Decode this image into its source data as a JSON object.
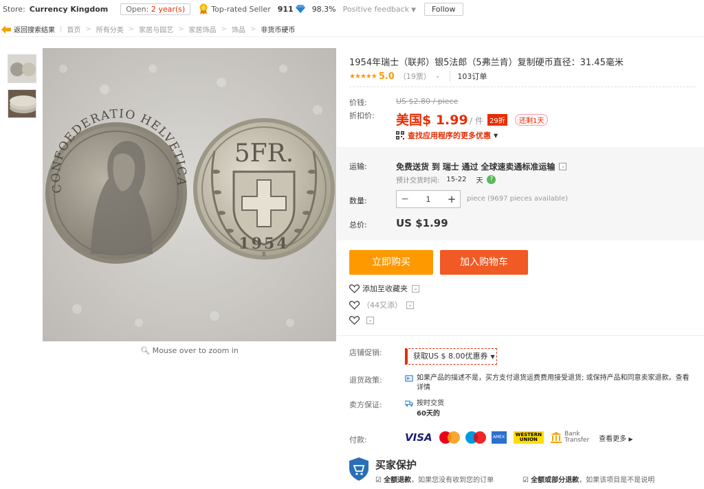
{
  "store": {
    "label": "Store:",
    "name": "Currency Kingdom",
    "open_prefix": "Open:",
    "open_years": "2 year(s)",
    "top_rated": "Top-rated Seller",
    "feedback_score": "911",
    "positive_pct": "98.3%",
    "positive_label": "Positive feedback",
    "follow": "Follow"
  },
  "breadcrumb": {
    "back": "返回搜索结果",
    "items": [
      "首页",
      "所有分类",
      "家居与园艺",
      "家居饰品",
      "饰品"
    ],
    "current": "非货币硬币"
  },
  "gallery": {
    "zoom_hint": "Mouse over to zoom in",
    "coin_left_text": "CONFOEDERATIO HELVETICA",
    "coin_right_denom": "5FR.",
    "coin_right_year": "1954",
    "coin_right_mint": "B"
  },
  "product": {
    "title": "1954年瑞士（联邦）银5法郎（5弗兰肯）复制硬币直径：31.45毫米",
    "rating": "5.0",
    "rating_count": "（19票）",
    "orders": "103订单"
  },
  "price": {
    "label_price": "价钱:",
    "old_price": "US $2.80 / piece",
    "label_discount": "折扣价:",
    "new_price": "美国$ 1.99",
    "per_piece": "/ 件",
    "discount_badge": "29折",
    "days_left": "还剩1天",
    "app_deal": "查找应用程序的更多优惠"
  },
  "shipping": {
    "label": "运输:",
    "text_free": "免费送货",
    "text_to": "到",
    "text_country": "瑞士",
    "text_via": "通过",
    "text_method": "全球速卖通标准运输",
    "eta_label": "预计交货时间:",
    "eta_days": "15-22",
    "eta_unit": "天",
    "qty_label": "数量:",
    "qty_value": "1",
    "available": "piece (9697 pieces available)",
    "total_label": "总价:",
    "total_value": "US $1.99"
  },
  "actions": {
    "buy_now": "立即购买",
    "add_to_cart": "加入购物车",
    "add_wishlist": "添加至收藏夹",
    "wishlist_count": "（44又添）"
  },
  "store_info": {
    "promo_label": "店铺促销:",
    "coupon": "获取US $ 8.00优惠券",
    "return_label": "退货政策:",
    "return_text": "如果产品的描述不是，买方支付退货运费费用接受退货; 或保持产品和同意卖家退款。查看详情",
    "guarantee_label": "卖方保证:",
    "guarantee_line1": "按时交货",
    "guarantee_line2": "60天的",
    "payment_label": "付款:",
    "pay_visa": "VISA",
    "pay_amex": "AMEX",
    "pay_wu1": "WESTERN",
    "pay_wu2": "UNION",
    "pay_bank1": "Bank",
    "pay_bank2": "Transfer",
    "pay_more": "查看更多"
  },
  "protection": {
    "title": "买家保护",
    "item1_bold": "全额退款",
    "item1_rest": "，如果您没有收到您的订单",
    "item2_bold": "全额或部分退款",
    "item2_rest": "，如果该项目是不是说明"
  },
  "colors": {
    "accent_red": "#e62e04",
    "buy_orange": "#ff9900",
    "cart_orange": "#f15a24",
    "star": "#ff9900"
  }
}
